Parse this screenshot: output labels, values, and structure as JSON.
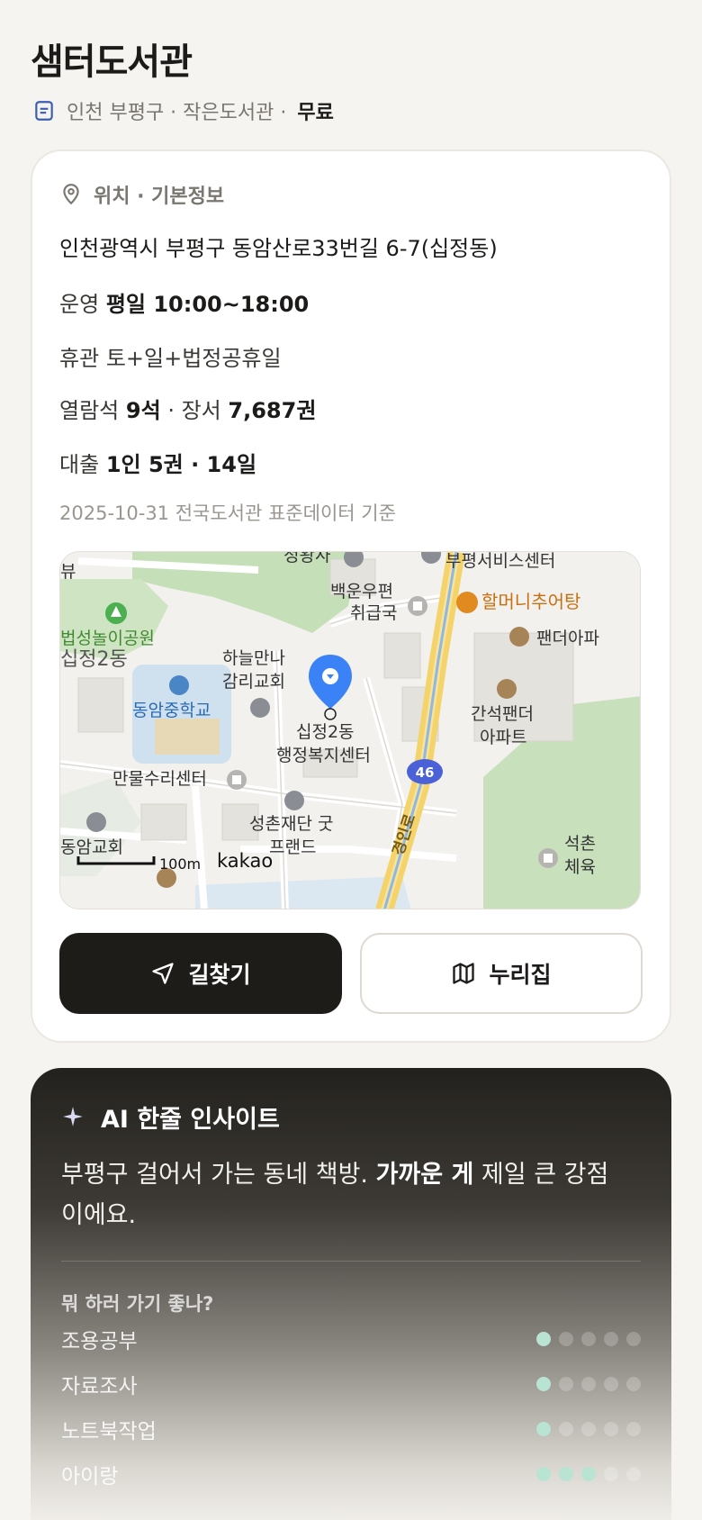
{
  "header": {
    "title": "샘터도서관",
    "subtitle": "인천 부평구 · 작은도서관 ·",
    "fee": "무료"
  },
  "info": {
    "section_title": "위치 · 기본정보",
    "address": "인천광역시 부평구 동암산로33번길 6-7(십정동)",
    "hours_label": "운영",
    "hours_value": "평일 10:00~18:00",
    "closed_label": "휴관",
    "closed_value": "토+일+법정공휴일",
    "seats_label": "열람석",
    "seats_value": "9석",
    "sep": "·",
    "books_label": "장서",
    "books_value": "7,687권",
    "loan_label": "대출",
    "loan_value": "1인 5권 · 14일",
    "source_note": "2025-10-31 전국도서관 표준데이터 기준"
  },
  "map": {
    "labels": {
      "jeongwangsa": "정왕사",
      "service_center": "부평서비스센터",
      "baekun": "백운우편",
      "baekun2": "취급국",
      "restaurant": "할머니추어탕",
      "pander": "팬더아파",
      "park": "법성놀이공원",
      "sipjeong2dong": "십정2동",
      "church1": "하늘만나",
      "church1b": "감리교회",
      "school": "동암중학교",
      "welfare1": "십정2동",
      "welfare2": "행정복지센터",
      "ganseok1": "간석팬더",
      "ganseok2": "아파트",
      "repair": "만물수리센터",
      "foundation1": "성촌재단 굿",
      "foundation2": "프랜드",
      "church2": "동암교회",
      "seokchon1": "석촌",
      "seokchon2": "체육",
      "road": "경인로",
      "route_no": "46",
      "view": "뷰",
      "scale": "100m",
      "brand": "kakao"
    }
  },
  "buttons": {
    "directions": "길찾기",
    "website": "누리집"
  },
  "insight": {
    "title": "AI 한줄 인사이트",
    "text_pre": "부평구 걸어서 가는 동네 책방. ",
    "text_bold": "가까운 게",
    "text_post": " 제일 큰 강점이에요.",
    "question": "뭐 하러 가기 좋나?",
    "activities": [
      {
        "label": "조용공부",
        "level": 1
      },
      {
        "label": "자료조사",
        "level": 1
      },
      {
        "label": "노트북작업",
        "level": 1
      },
      {
        "label": "아이랑",
        "level": 3
      }
    ]
  },
  "colors": {
    "accent_mint": "#b9e3d3",
    "pin_blue": "#3b82f6",
    "dark_button": "#1e1c18"
  }
}
